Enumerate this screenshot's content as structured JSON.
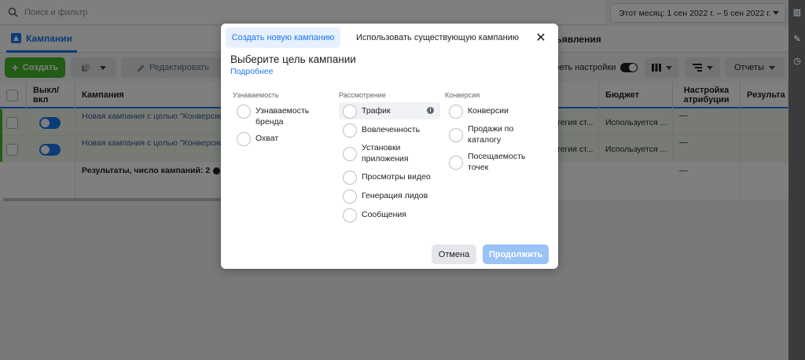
{
  "search": {
    "placeholder": "Поиск и фильтр"
  },
  "date_range": {
    "label": "Этот месяц: 1 сен 2022 г. – 5 сен 2022 г."
  },
  "tabs": {
    "campaigns": "Кампании",
    "ads": "ъявления"
  },
  "toolbar": {
    "create": "Создать",
    "edit": "Редактировать",
    "settings": "треть настройки",
    "reports": "Отчеты"
  },
  "table": {
    "headers": {
      "onoff": "Выкл/\nвкл",
      "campaign": "Кампания",
      "budget": "Бюджет",
      "attribution": "Настройка\nатрибуции",
      "results": "Результа"
    },
    "rows": [
      {
        "name": "Новая кампания с целью \"Конверсии\"",
        "strategy": "тегия ст...",
        "budget": "Используется ...",
        "attribution": "—"
      },
      {
        "name": "Новая кампания с целью \"Конверсии\"",
        "strategy": "тегия ст...",
        "budget": "Используется ...",
        "attribution": "—"
      }
    ],
    "total": {
      "label": "Результаты, число кампаний: 2",
      "attribution": "—"
    }
  },
  "modal": {
    "tab_new": "Создать новую кампанию",
    "tab_existing": "Использовать существующую кампанию",
    "title": "Выберите цель кампании",
    "learn_more": "Подробнее",
    "columns": {
      "awareness": {
        "heading": "Узнаваемость",
        "options": [
          "Узнаваемость бренда",
          "Охват"
        ]
      },
      "consideration": {
        "heading": "Рассмотрение",
        "options": [
          "Трафик",
          "Вовлеченность",
          "Установки приложения",
          "Просмотры видео",
          "Генерация лидов",
          "Сообщения"
        ]
      },
      "conversion": {
        "heading": "Конверсия",
        "options": [
          "Конверсии",
          "Продажи по каталогу",
          "Посещаемость точек"
        ]
      }
    },
    "cancel": "Отмена",
    "continue": "Продолжить"
  },
  "colors": {
    "accent": "#1877f2",
    "create_green": "#42b72a"
  }
}
